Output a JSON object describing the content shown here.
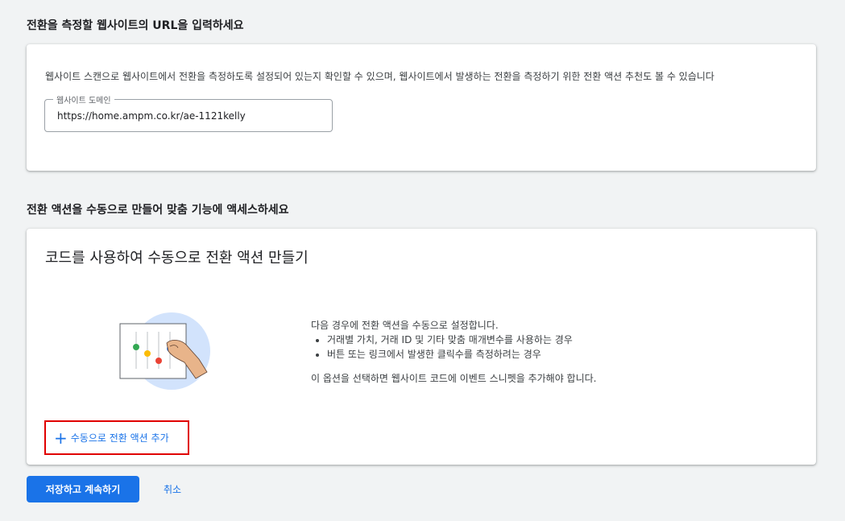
{
  "section1": {
    "title": "전환을 측정할 웹사이트의 URL을 입력하세요",
    "description": "웹사이트 스캔으로 웹사이트에서 전환을 측정하도록 설정되어 있는지 확인할 수 있으며, 웹사이트에서 발생하는 전환을 측정하기 위한 전환 액션 추천도 볼 수 있습니다",
    "domain_field": {
      "label": "웹사이트 도메인",
      "value": "https://home.ampm.co.kr/ae-1121kelly"
    }
  },
  "section2": {
    "title": "전환 액션을 수동으로 만들어 맞춤 기능에 액세스하세요",
    "card_heading": "코드를 사용하여 수동으로 전환 액션 만들기",
    "info_intro": "다음 경우에 전환 액션을 수동으로 설정합니다.",
    "bullets": [
      "거래별 가치, 거래 ID 및 기타 맞춤 매개변수를 사용하는 경우",
      "버튼 또는 링크에서 발생한 클릭수를 측정하려는 경우"
    ],
    "note": "이 옵션을 선택하면 웹사이트 코드에 이벤트 스니펫을 추가해야 합니다.",
    "add_button_label": "수동으로 전환 액션 추가"
  },
  "footer": {
    "save_label": "저장하고 계속하기",
    "cancel_label": "취소"
  },
  "colors": {
    "accent": "#1a73e8",
    "highlight": "#e00000"
  }
}
